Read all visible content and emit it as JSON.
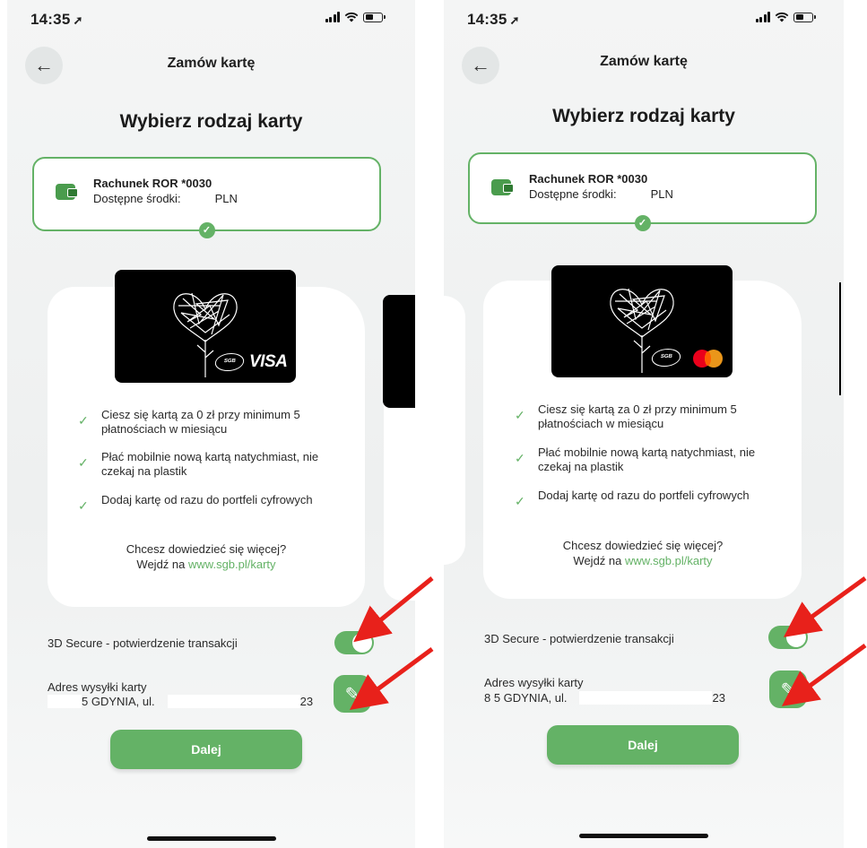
{
  "screens": [
    {
      "time": "14:35",
      "header_title": "Zamów kartę",
      "heading": "Wybierz rodzaj karty",
      "account": {
        "name": "Rachunek ROR *0030",
        "balance_label": "Dostępne środki:",
        "currency": "PLN"
      },
      "card_brand": "VISA",
      "features": [
        "Ciesz się kartą za 0 zł przy minimum 5 płatnościach w miesiącu",
        "Płać mobilnie nową kartą natychmiast, nie czekaj na plastik",
        "Dodaj kartę od razu do portfeli cyfrowych"
      ],
      "more_line1": "Chcesz dowiedzieć się więcej?",
      "more_prefix": "Wejdź na",
      "more_link": "www.sgb.pl/karty",
      "secure_label": "3D Secure - potwierdzenie transakcji",
      "secure_enabled": true,
      "address_label": "Adres wysyłki karty",
      "address_line": "5 GDYNIA, ul.",
      "address_suffix": "23",
      "cta": "Dalej"
    },
    {
      "time": "14:35",
      "header_title": "Zamów kartę",
      "heading": "Wybierz rodzaj karty",
      "account": {
        "name": "Rachunek ROR *0030",
        "balance_label": "Dostępne środki:",
        "currency": "PLN"
      },
      "card_brand": "Mastercard",
      "features": [
        "Ciesz się kartą za 0 zł przy minimum 5 płatnościach w miesiącu",
        "Płać mobilnie nową kartą natychmiast, nie czekaj na plastik",
        "Dodaj kartę od razu do portfeli cyfrowych"
      ],
      "more_line1": "Chcesz dowiedzieć się więcej?",
      "more_prefix": "Wejdź na",
      "more_link": "www.sgb.pl/karty",
      "secure_label": "3D Secure - potwierdzenie transakcji",
      "secure_enabled": true,
      "address_label": "Adres wysyłki karty",
      "address_line": "8 5 GDYNIA, ul.",
      "address_suffix": "23",
      "cta": "Dalej"
    }
  ],
  "card_logo_text": "SGB",
  "colors": {
    "accent": "#64b266",
    "annotation": "#e8211b"
  }
}
